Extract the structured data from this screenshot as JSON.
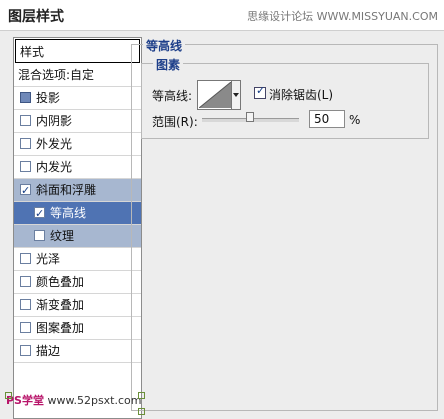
{
  "window": {
    "title": "图层样式",
    "watermark_top": "思缘设计论坛 WWW.MISSYUAN.COM"
  },
  "sidebar": {
    "header": "样式",
    "blend_options": "混合选项:自定",
    "items": [
      {
        "label": "投影",
        "checked": false,
        "filled": true
      },
      {
        "label": "内阴影",
        "checked": false
      },
      {
        "label": "外发光",
        "checked": false
      },
      {
        "label": "内发光",
        "checked": false
      },
      {
        "label": "斜面和浮雕",
        "checked": true
      },
      {
        "label": "等高线",
        "checked": true
      },
      {
        "label": "纹理",
        "checked": false
      },
      {
        "label": "光泽",
        "checked": false
      },
      {
        "label": "颜色叠加",
        "checked": false
      },
      {
        "label": "渐变叠加",
        "checked": false
      },
      {
        "label": "图案叠加",
        "checked": false
      },
      {
        "label": "描边",
        "checked": false
      }
    ]
  },
  "panel": {
    "group_title": "等高线",
    "sub_title": "图素",
    "contour_label": "等高线:",
    "antialias_label": "消除锯齿(L)",
    "range_label": "范围(R):",
    "range_value": "50",
    "range_unit": "%",
    "range_slider_fraction": 0.5
  },
  "watermark_bottom": {
    "ps": "PS学堂",
    "site": "www.52psxt.com"
  },
  "colors": {
    "selection_light": "#a7b7d0",
    "selection_dark": "#4f73b3",
    "legend_blue": "#1e3f8a"
  }
}
